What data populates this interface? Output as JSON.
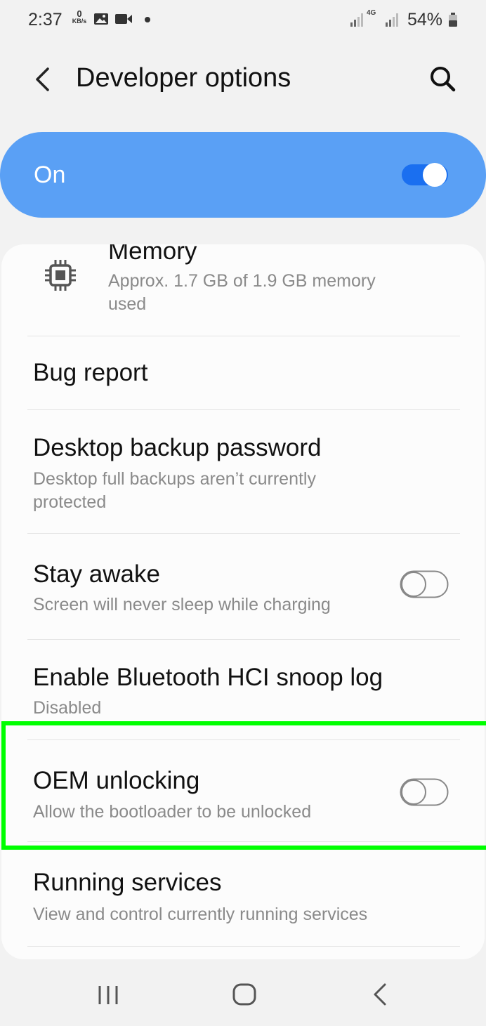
{
  "status_bar": {
    "time": "2:37",
    "net_speed_value": "0",
    "net_speed_unit": "KB/s",
    "network_type": "4G",
    "battery": "54%"
  },
  "header": {
    "title": "Developer options"
  },
  "master_switch": {
    "label": "On",
    "state": true,
    "color": "#5aa0f5"
  },
  "items": [
    {
      "title": "Memory",
      "subtitle": "Approx. 1.7 GB of 1.9 GB memory used",
      "icon": "memory-chip-icon"
    },
    {
      "title": "Bug report"
    },
    {
      "title": "Desktop backup password",
      "subtitle": "Desktop full backups aren’t currently protected"
    },
    {
      "title": "Stay awake",
      "subtitle": "Screen will never sleep while charging",
      "toggle": false
    },
    {
      "title": "Enable Bluetooth HCI snoop log",
      "subtitle": "Disabled"
    },
    {
      "title": "OEM unlocking",
      "subtitle": "Allow the bootloader to be unlocked",
      "toggle": false,
      "highlighted": true
    },
    {
      "title": "Running services",
      "subtitle": "View and control currently running services"
    }
  ],
  "highlight_color": "#00ff00",
  "nav_bar": {
    "icons": [
      "recent-apps-icon",
      "home-icon",
      "back-icon"
    ]
  }
}
